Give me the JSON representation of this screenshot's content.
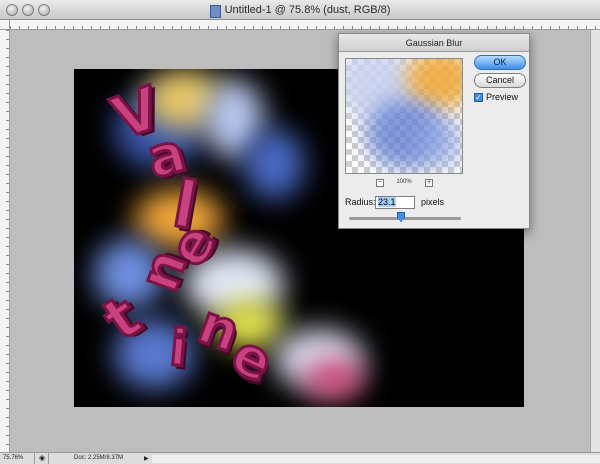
{
  "window": {
    "title": "Untitled-1 @ 75.8% (dust, RGB/8)"
  },
  "canvas": {
    "letters": [
      "V",
      "a",
      "l",
      "e",
      "n",
      "t",
      "i",
      "n",
      "e"
    ]
  },
  "dialog": {
    "title": "Gaussian Blur",
    "ok_label": "OK",
    "cancel_label": "Cancel",
    "preview_label": "Preview",
    "preview_checked": true,
    "zoom_minus": "−",
    "zoom_plus": "+",
    "zoom_level": "100%",
    "radius_label": "Radius:",
    "radius_value": "23.1",
    "radius_unit": "pixels"
  },
  "status": {
    "zoom": "75.76%",
    "doc": "Doc: 2.25M/8.37M"
  },
  "colors": {
    "letter_fill": "#c7427f",
    "accent_blue": "#3d8fe8"
  }
}
